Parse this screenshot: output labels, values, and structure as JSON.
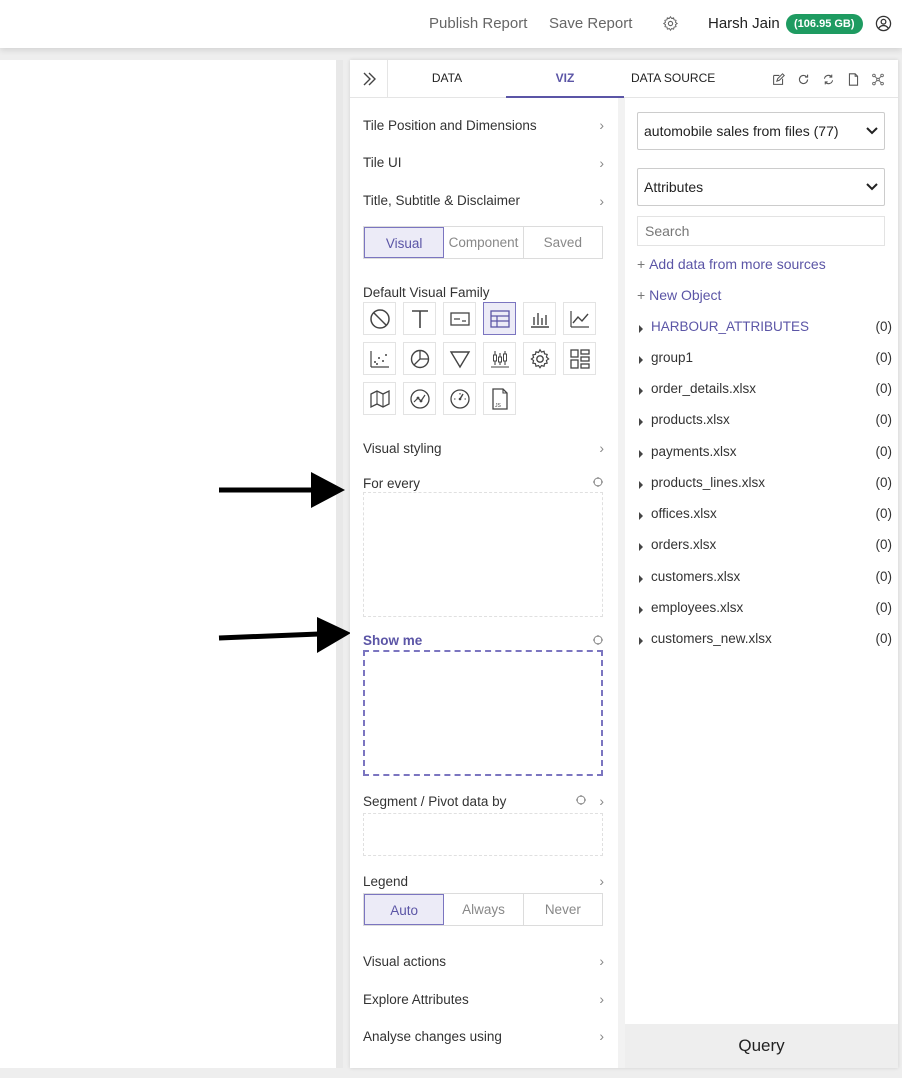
{
  "topbar": {
    "publish_label": "Publish Report",
    "save_label": "Save Report",
    "user_name": "Harsh Jain",
    "storage_badge": "(106.95 GB)",
    "badge_color": "#1e9b61"
  },
  "panel": {
    "tabs": [
      {
        "label": "DATA",
        "active": false
      },
      {
        "label": "VIZ",
        "active": true
      }
    ],
    "datasource_title": "DATA SOURCE",
    "accent_color": "#5b55a6"
  },
  "viz": {
    "sections": {
      "tile_position": "Tile Position and Dimensions",
      "tile_ui": "Tile UI",
      "title_subtitle": "Title, Subtitle & Disclaimer",
      "default_family": "Default Visual Family",
      "visual_styling": "Visual styling",
      "for_every": "For every",
      "show_me": "Show me",
      "segment": "Segment / Pivot data by",
      "legend": "Legend",
      "visual_actions": "Visual actions",
      "explore": "Explore Attributes",
      "analyse": "Analyse changes using"
    },
    "mode_tabs": [
      "Visual",
      "Component",
      "Saved"
    ],
    "mode_selected": "Visual",
    "legend_options": [
      "Auto",
      "Always",
      "Never"
    ],
    "legend_selected": "Auto",
    "visual_families": [
      "none-icon",
      "text-icon",
      "card-icon",
      "table-icon",
      "bar-chart-icon",
      "line-chart-icon",
      "scatter-icon",
      "pie-icon",
      "funnel-icon",
      "candlestick-icon",
      "gear-icon",
      "grid-icon",
      "map-icon",
      "network-icon",
      "gauge-icon",
      "js-file-icon"
    ],
    "selected_family": "table-icon"
  },
  "datasource": {
    "source_select": "automobile sales from files (77)",
    "type_select": "Attributes",
    "search_placeholder": "Search",
    "add_more": "Add data from more sources",
    "new_object": "New Object",
    "items": [
      {
        "name": "HARBOUR_ATTRIBUTES",
        "count": "(0)",
        "highlight": true
      },
      {
        "name": "group1",
        "count": "(0)"
      },
      {
        "name": "order_details.xlsx",
        "count": "(0)"
      },
      {
        "name": "products.xlsx",
        "count": "(0)"
      },
      {
        "name": "payments.xlsx",
        "count": "(0)"
      },
      {
        "name": "products_lines.xlsx",
        "count": "(0)"
      },
      {
        "name": "offices.xlsx",
        "count": "(0)"
      },
      {
        "name": "orders.xlsx",
        "count": "(0)"
      },
      {
        "name": "customers.xlsx",
        "count": "(0)"
      },
      {
        "name": "employees.xlsx",
        "count": "(0)"
      },
      {
        "name": "customers_new.xlsx",
        "count": "(0)"
      }
    ],
    "query_label": "Query"
  }
}
